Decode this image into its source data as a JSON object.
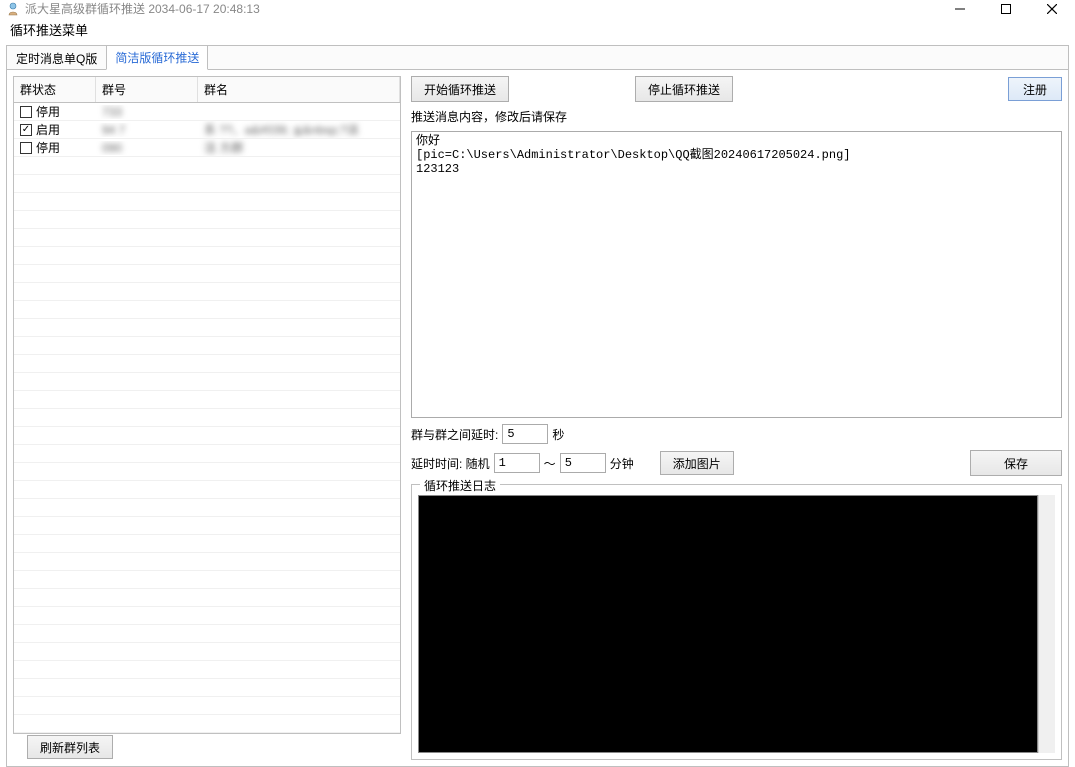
{
  "window": {
    "title": "派大星高级群循环推送 2034-06-17 20:48:13"
  },
  "menu": {
    "label": "循环推送菜单"
  },
  "tabs": [
    {
      "label": "定时消息单Q版",
      "active": false
    },
    {
      "label": "简洁版循环推送",
      "active": true
    }
  ],
  "grouplist": {
    "headers": {
      "status": "群状态",
      "number": "群号",
      "name": "群名"
    },
    "rows": [
      {
        "checked": false,
        "status": "停用",
        "number": "      733",
        "name": ""
      },
      {
        "checked": true,
        "status": "启用",
        "number": "94       7",
        "name": "系     ??、a&#039; ≦&nbsp;?派"
      },
      {
        "checked": false,
        "status": "停用",
        "number": "     090",
        "name": "活      方群"
      }
    ],
    "refresh": "刷新群列表"
  },
  "right": {
    "start_btn": "开始循环推送",
    "stop_btn": "停止循环推送",
    "register_btn": "注册",
    "msg_label": "推送消息内容，修改后请保存",
    "msg_value": "你好\n[pic=C:\\Users\\Administrator\\Desktop\\QQ截图20240617205024.png]\n123123",
    "delay_between_label": "群与群之间延时:",
    "delay_between_value": "5",
    "seconds_label": "秒",
    "delay_range_label": "延时时间: 随机",
    "delay_min": "1",
    "range_sep": "～",
    "delay_max": "5",
    "minutes_label": "分钟",
    "add_pic_btn": "添加图片",
    "save_btn": "保存",
    "log_legend": "循环推送日志"
  }
}
